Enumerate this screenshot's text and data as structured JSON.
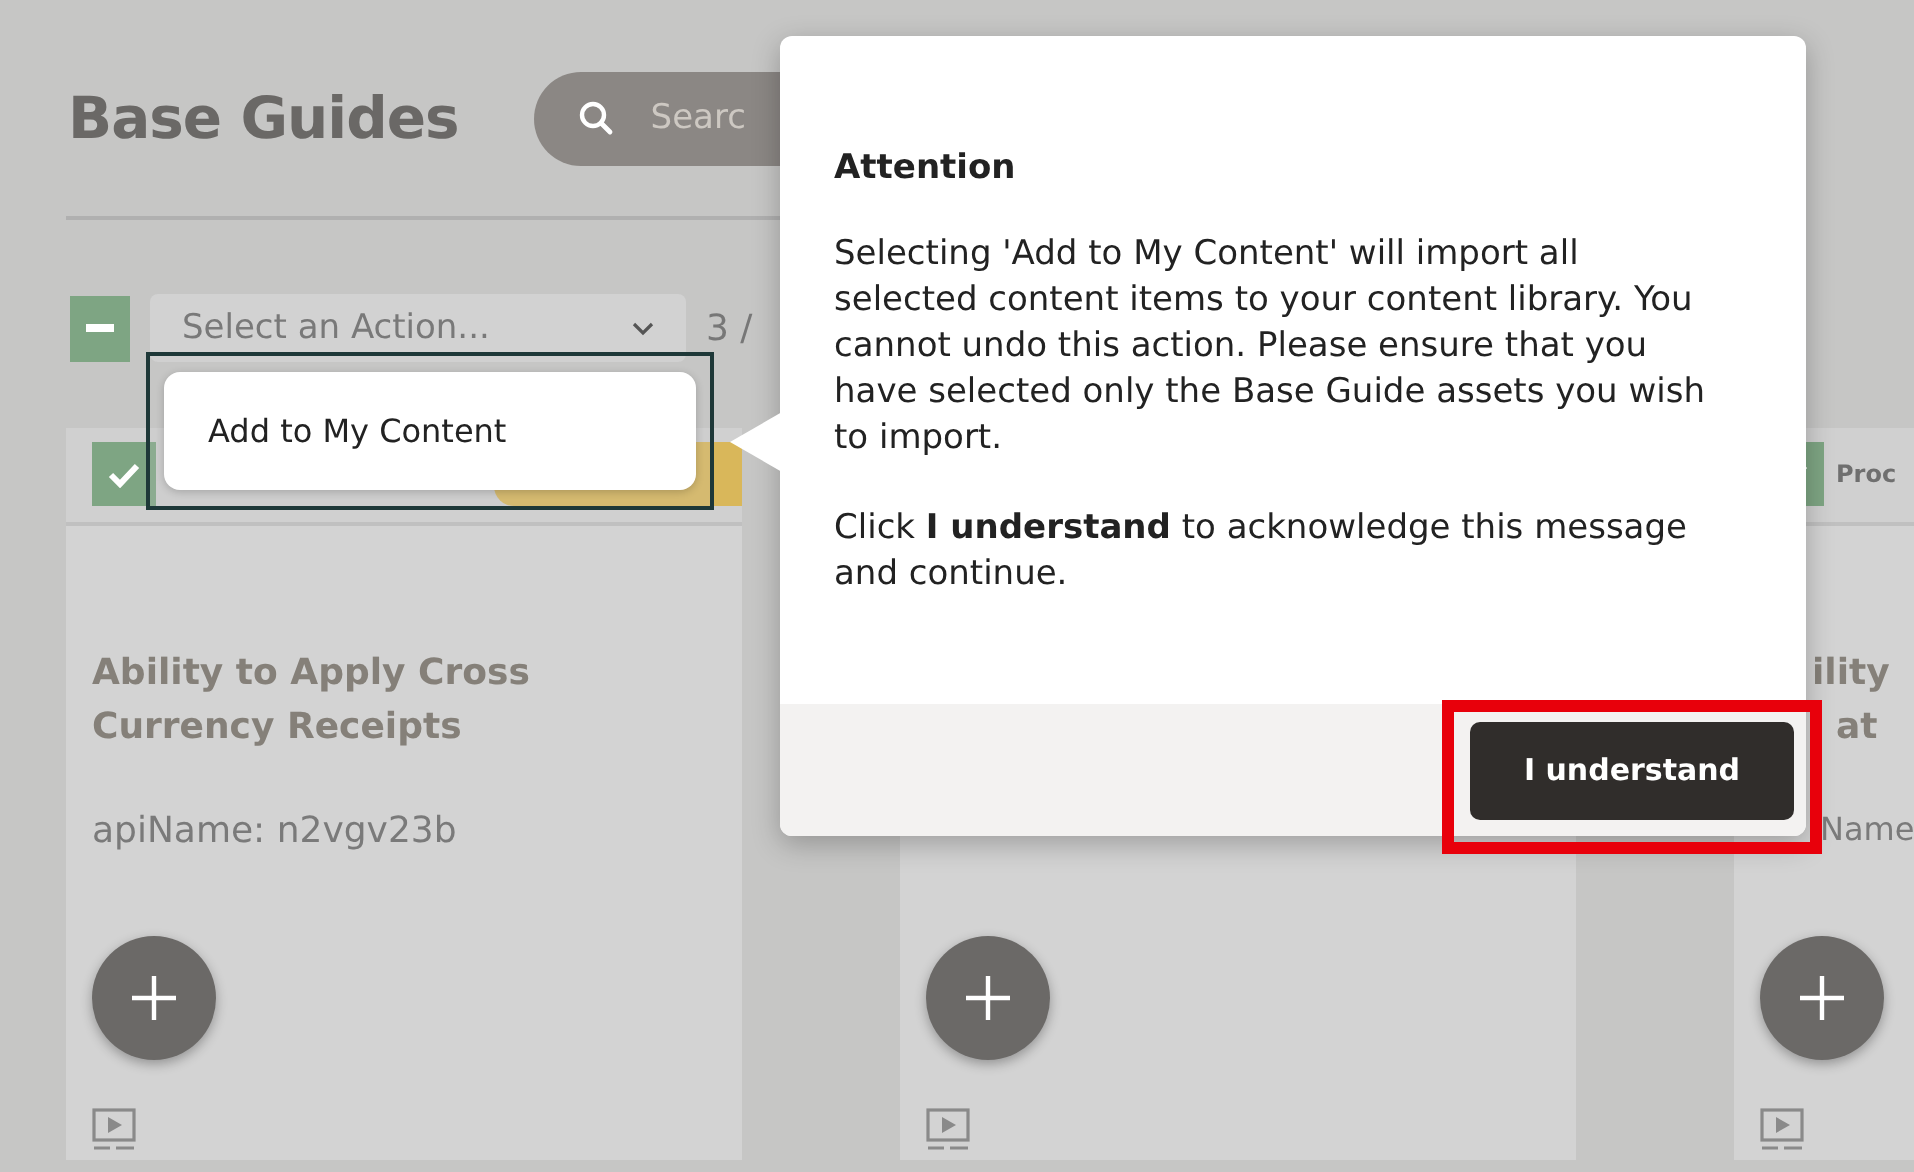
{
  "page": {
    "title": "Base Guides",
    "search": {
      "placeholder": "Searc"
    }
  },
  "toolbar": {
    "select_all": {
      "mixed": true
    },
    "action_select": {
      "placeholder": "Select an Action..."
    },
    "count": "3 /"
  },
  "action_menu": {
    "items": [
      {
        "label": "Add to My Content"
      }
    ]
  },
  "cards": [
    {
      "kind": "full",
      "checked": true,
      "title_lines": [
        "Ability to Apply Cross",
        "Currency Receipts"
      ],
      "api_name": "apiName: n2vgv23b"
    },
    {
      "kind": "covered"
    },
    {
      "kind": "edge",
      "checked": true,
      "tag": "Proc",
      "title_lines": [
        "ility",
        "at"
      ],
      "api_name": "Name"
    }
  ],
  "dialog": {
    "title": "Attention",
    "paragraphs": [
      "Selecting 'Add to My Content' will import all selected content items to your content library. You cannot undo this action. Please ensure that you have selected only the Base Guide assets you wish to import.",
      "Click **I understand** to acknowledge this message and continue."
    ],
    "button": "I understand",
    "highlighted": true
  }
}
